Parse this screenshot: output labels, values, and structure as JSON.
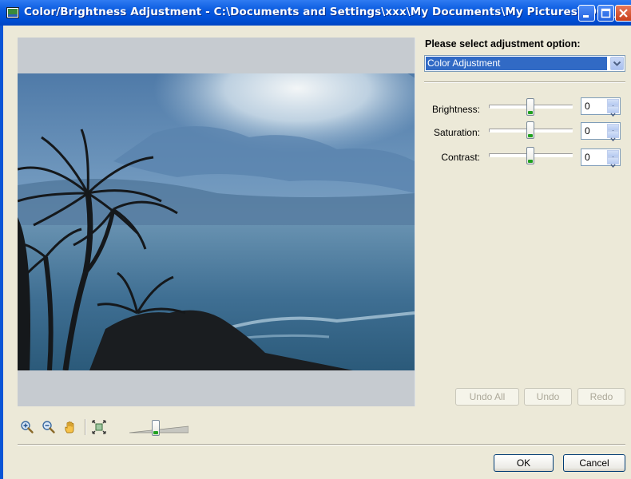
{
  "window": {
    "title": "Color/Brightness Adjustment - C:\\Documents and Settings\\xxx\\My Documents\\My Pictures\\200X_01...",
    "icon": "picture-window-icon",
    "titlebar_buttons": [
      "minimize-icon",
      "maximize-icon",
      "close-icon"
    ]
  },
  "adjustment": {
    "prompt": "Please select adjustment option:",
    "selected": "Color Adjustment",
    "controls": [
      {
        "label": "Brightness:",
        "value": "0",
        "slider_fraction": 0.5
      },
      {
        "label": "Saturation:",
        "value": "0",
        "slider_fraction": 0.5
      },
      {
        "label": "Contrast:",
        "value": "0",
        "slider_fraction": 0.5
      }
    ]
  },
  "history": {
    "undo_all": "Undo All",
    "undo": "Undo",
    "redo": "Redo"
  },
  "toolbar": {
    "icons": [
      "zoom-in-icon",
      "zoom-out-icon",
      "hand-pan-icon",
      "fit-to-window-icon"
    ],
    "zoom_fraction": 0.45
  },
  "dialog": {
    "ok": "OK",
    "cancel": "Cancel"
  },
  "colors": {
    "titlebar": "#0a5be0",
    "selection": "#316ac5",
    "slider_grip": "#21a121"
  }
}
